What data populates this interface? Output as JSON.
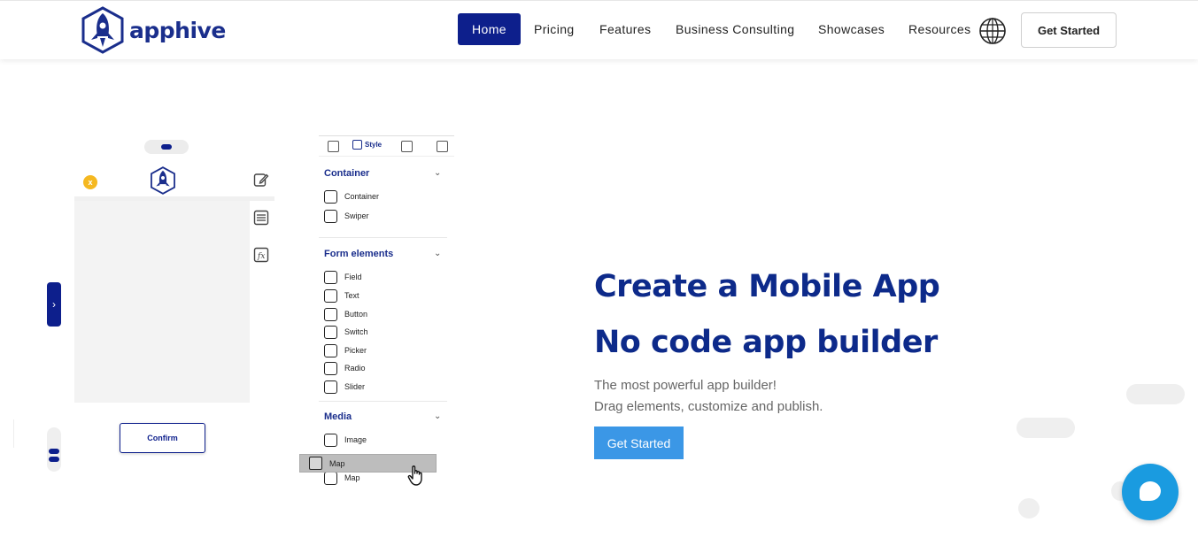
{
  "header": {
    "logo_text": "apphive",
    "nav": {
      "home": "Home",
      "pricing": "Pricing",
      "features": "Features",
      "business": "Business Consulting",
      "showcases": "Showcases",
      "resources": "Resources"
    },
    "cta": "Get Started"
  },
  "builder": {
    "close_badge": "x",
    "confirm_label": "Confirm",
    "panel": {
      "style_tab": "Style",
      "sections": [
        {
          "title": "Container",
          "items": [
            "Container",
            "Swiper"
          ]
        },
        {
          "title": "Form elements",
          "items": [
            "Field",
            "Text",
            "Button",
            "Switch",
            "Picker",
            "Radio",
            "Slider"
          ]
        },
        {
          "title": "Media",
          "items": [
            "Image",
            "Map"
          ]
        }
      ],
      "dragging_item": "Map"
    }
  },
  "hero": {
    "title_line1": "Create a Mobile App",
    "title_line2": "No code app builder",
    "subtitle_line1": "The most powerful app builder!",
    "subtitle_line2": "Drag elements, customize and publish.",
    "cta": "Get Started"
  },
  "colors": {
    "brand_navy": "#0d1f8c",
    "cta_blue": "#3b97e6",
    "chat_blue": "#1a9be0"
  }
}
